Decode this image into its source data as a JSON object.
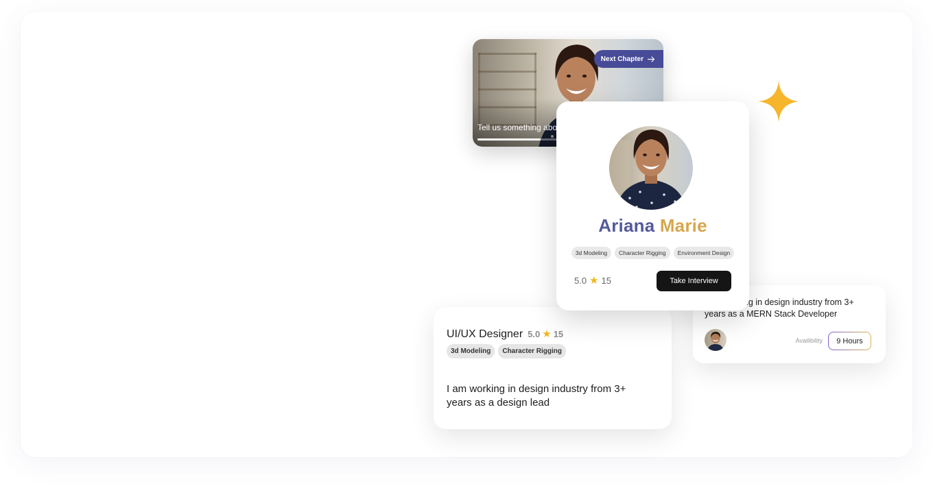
{
  "video": {
    "next_chapter_label": "Next Chapter",
    "caption": "Tell us something abo",
    "progress": 0.42
  },
  "profile": {
    "first_name": "Ariana",
    "last_name": "Marie",
    "tags": [
      "3d Modeling",
      "Character Rigging",
      "Environment Design"
    ],
    "rating": "5.0",
    "reviews": "15",
    "cta_label": "Take Interview"
  },
  "designer": {
    "title": "UI/UX Designer",
    "rating": "5.0",
    "reviews": "15",
    "tags": [
      "3d Modeling",
      "Character Rigging"
    ],
    "description": "I am working in design industry from 3+ years as a design lead"
  },
  "mern": {
    "description": "I am working in design industry from 3+ years as a MERN Stack Developer",
    "availability_label": "Availibility",
    "hours": "9 Hours"
  },
  "colors": {
    "accent_indigo": "#474b98",
    "name_first": "#545a9c",
    "name_last": "#d6a74d",
    "sparkle": "#f6b52a",
    "star": "#f3b41a"
  }
}
